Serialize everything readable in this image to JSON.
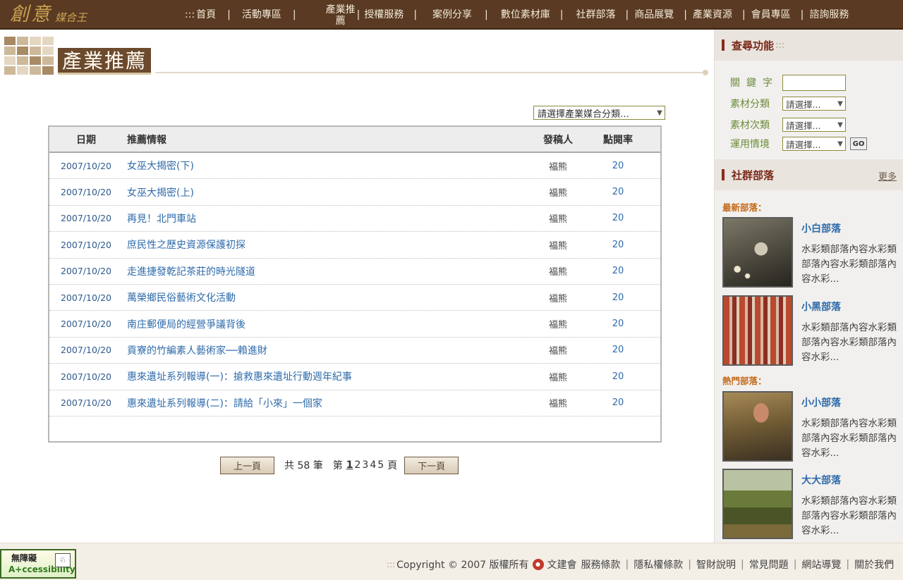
{
  "brand": {
    "main": "創意",
    "sub": "媒合王"
  },
  "nav": {
    "prefix": ":::",
    "items": [
      "首頁",
      "活動專區",
      "產業推薦",
      "授權服務",
      "案例分享",
      "數位素材庫",
      "社群部落",
      "商品展覽",
      "產業資源",
      "會員專區",
      "諮詢服務"
    ],
    "separator": "|"
  },
  "page": {
    "title": "產業推薦"
  },
  "category_select": {
    "value": "請選擇產業媒合分類…"
  },
  "table": {
    "headers": {
      "date": "日期",
      "title": "推薦情報",
      "author": "發稿人",
      "hits": "點閱率"
    },
    "rows": [
      {
        "date": "2007/10/20",
        "title": "女巫大揭密(下)",
        "author": "福熊",
        "hits": "20"
      },
      {
        "date": "2007/10/20",
        "title": "女巫大揭密(上)",
        "author": "福熊",
        "hits": "20"
      },
      {
        "date": "2007/10/20",
        "title": "再見！北門車站",
        "author": "福熊",
        "hits": "20"
      },
      {
        "date": "2007/10/20",
        "title": "庶民性之歷史資源保護初探",
        "author": "福熊",
        "hits": "20"
      },
      {
        "date": "2007/10/20",
        "title": "走進捷發乾記茶莊的時光隧道",
        "author": "福熊",
        "hits": "20"
      },
      {
        "date": "2007/10/20",
        "title": "萬榮鄉民俗藝術文化活動",
        "author": "福熊",
        "hits": "20"
      },
      {
        "date": "2007/10/20",
        "title": "南庄郵便局的經營爭議背後",
        "author": "福熊",
        "hits": "20"
      },
      {
        "date": "2007/10/20",
        "title": "貢寮的竹編素人藝術家──賴進財",
        "author": "福熊",
        "hits": "20"
      },
      {
        "date": "2007/10/20",
        "title": "惠來遺址系列報導(一)：搶救惠來遺址行動週年紀事",
        "author": "福熊",
        "hits": "20"
      },
      {
        "date": "2007/10/20",
        "title": "惠來遺址系列報導(二)：請給「小來」一個家",
        "author": "福熊",
        "hits": "20"
      }
    ]
  },
  "pager": {
    "prev": "上一頁",
    "next": "下一頁",
    "total_label": "共 58 筆",
    "page_prefix": "第",
    "page_suffix": "頁",
    "pages": [
      "1",
      "2",
      "3",
      "4",
      "5"
    ],
    "current": "1"
  },
  "search": {
    "title": "查尋功能",
    "dots": ":::",
    "keyword_label": "關鍵字",
    "keyword_value": "",
    "category_label": "素材分類",
    "category_value": "請選擇...",
    "subcategory_label": "素材次類",
    "subcategory_value": "請選擇...",
    "usage_label": "運用情境",
    "usage_value": "請選擇...",
    "go_label": "GO"
  },
  "blogs": {
    "title": "社群部落",
    "more": "更多",
    "newest_label": "最新部落：",
    "popular_label": "熱門部落：",
    "newest": [
      {
        "name": "小白部落",
        "desc": "水彩類部落內容水彩類部落內容水彩類部落內容水彩..."
      },
      {
        "name": "小黑部落",
        "desc": "水彩類部落內容水彩類部落內容水彩類部落內容水彩..."
      }
    ],
    "popular": [
      {
        "name": "小小部落",
        "desc": "水彩類部落內容水彩類部落內容水彩類部落內容水彩..."
      },
      {
        "name": "大大部落",
        "desc": "水彩類部落內容水彩類部落內容水彩類部落內容水彩..."
      }
    ]
  },
  "footer": {
    "dots": ":::",
    "copyright": "Copyright © 2007 版權所有",
    "org": "文建會",
    "links": [
      "服務條款",
      "隱私權條款",
      "智財說明",
      "常見問題",
      "網站導覽",
      "關於我們"
    ],
    "a11y_top": "無障礙",
    "a11y_bottom": "A+ccessibility"
  },
  "colors": {
    "topbar": "#5a3a22",
    "accent": "#7a2a1a",
    "link": "#2e6bab"
  }
}
